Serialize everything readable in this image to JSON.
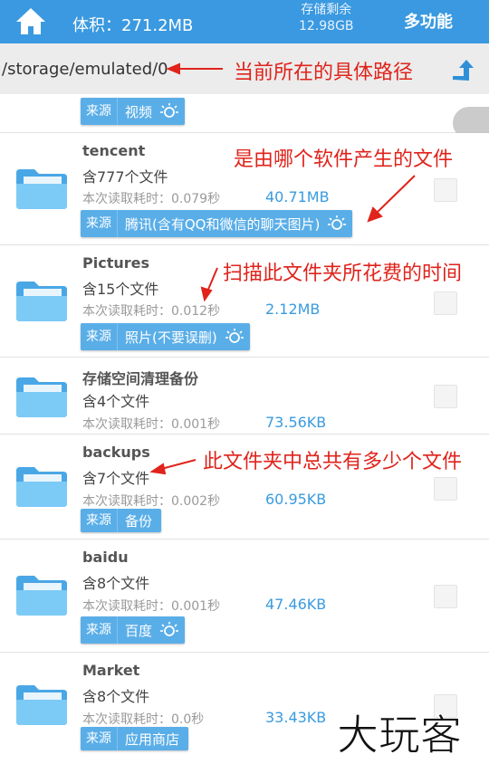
{
  "header": {
    "volume_label": "体积：271.2MB",
    "remain_label": "存储剩余",
    "remain_value": "12.98GB",
    "multi_label": "多功能",
    "home_icon": "home-icon",
    "accent": "#3a99e0"
  },
  "path": {
    "value": "/storage/emulated/0",
    "up_icon": "up-arrow-icon"
  },
  "annotations": {
    "path": "当前所在的具体路径",
    "source": "是由哪个软件产生的文件",
    "time": "扫描此文件夹所花费的时间",
    "count": "此文件夹中总共有多少个文件"
  },
  "partial_row": {
    "src": "来源",
    "tag": "视频"
  },
  "rows": [
    {
      "name": "tencent",
      "count": "含777个文件",
      "time": "本次读取耗时：0.079秒",
      "size": "40.71MB",
      "src": "来源",
      "tag": "腾讯(含有QQ和微信的聊天图片)",
      "bulb": true
    },
    {
      "name": "Pictures",
      "count": "含15个文件",
      "time": "本次读取耗时：0.012秒",
      "size": "2.12MB",
      "src": "来源",
      "tag": "照片(不要误删)",
      "bulb": true
    },
    {
      "name": "存储空间清理备份",
      "count": "含4个文件",
      "time": "本次读取耗时：0.001秒",
      "size": "73.56KB"
    },
    {
      "name": "backups",
      "count": "含7个文件",
      "time": "本次读取耗时：0.002秒",
      "size": "60.95KB",
      "src": "来源",
      "tag": "备份",
      "bulb": false
    },
    {
      "name": "baidu",
      "count": "含8个文件",
      "time": "本次读取耗时：0.001秒",
      "size": "47.46KB",
      "src": "来源",
      "tag": "百度",
      "bulb": true
    },
    {
      "name": "Market",
      "count": "含8个文件",
      "time": "本次读取耗时：0.0秒",
      "size": "33.43KB",
      "src": "来源",
      "tag": "应用商店",
      "bulb": false
    }
  ],
  "watermark": "大玩客"
}
